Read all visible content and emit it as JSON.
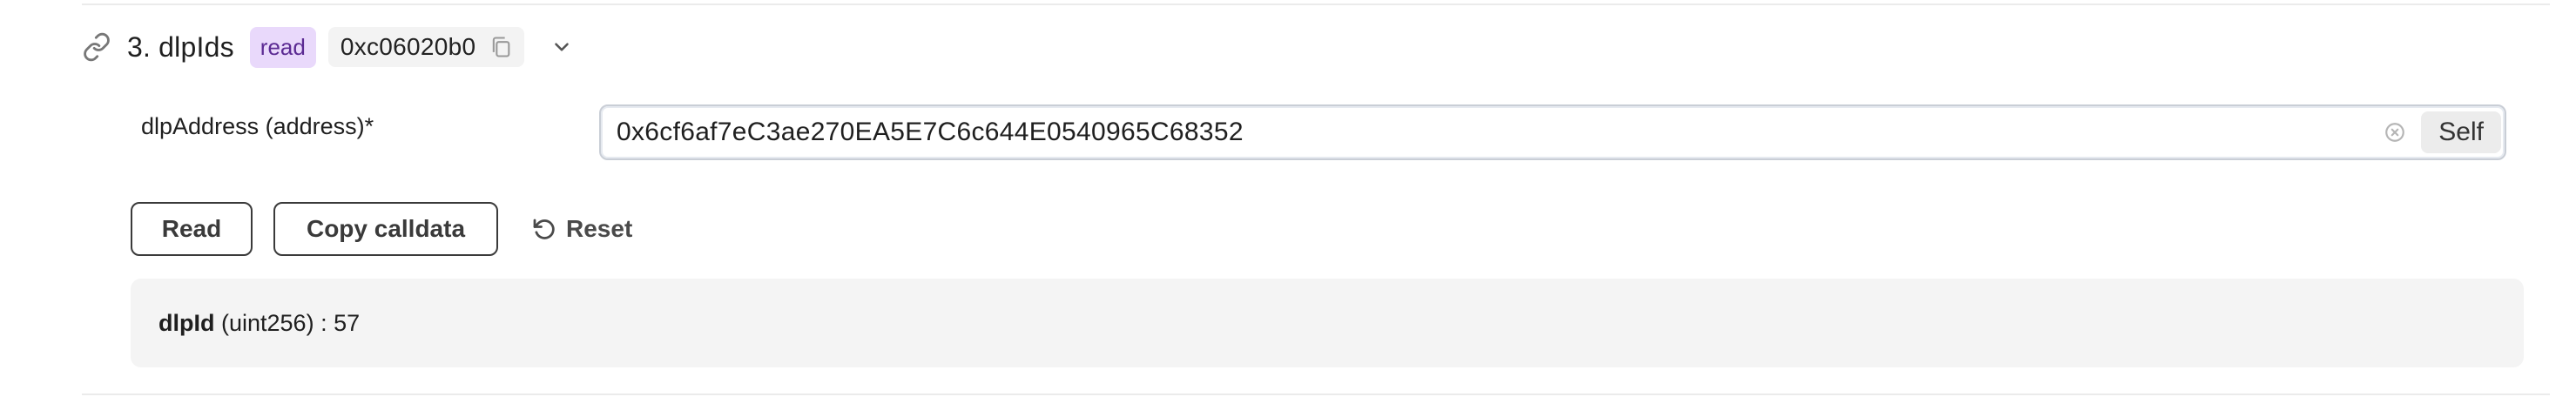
{
  "function": {
    "title": "3. dlpIds",
    "badge": "read",
    "selector": "0xc06020b0"
  },
  "param": {
    "label": "dlpAddress (address)*",
    "value": "0x6cf6af7eC3ae270EA5E7C6c644E0540965C68352",
    "self_label": "Self"
  },
  "actions": {
    "read_label": "Read",
    "copy_calldata_label": "Copy calldata",
    "reset_label": "Reset"
  },
  "result": {
    "name": "dlpId",
    "type": "(uint256)",
    "separator": ":",
    "value": "57"
  },
  "icons": {
    "link": "link-icon",
    "copy": "copy-icon",
    "chevron": "chevron-down-icon",
    "clear": "clear-icon",
    "reset": "reset-icon"
  },
  "colors": {
    "badge_bg": "#e9d9fb",
    "badge_text": "#5b2a93",
    "result_bg": "#f4f4f4"
  }
}
